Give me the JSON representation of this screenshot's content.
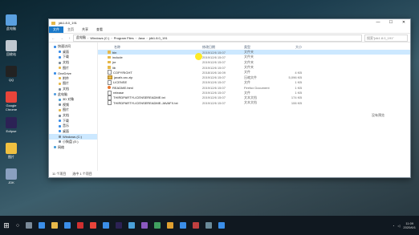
{
  "desktop_icons": [
    {
      "label": "此电脑",
      "color": "#5aa0e0"
    },
    {
      "label": "回收站",
      "color": "#c0c8d0"
    },
    {
      "label": "QQ",
      "color": "#222222"
    },
    {
      "label": "Google Chrome",
      "color": "#e8443a"
    },
    {
      "label": "Eclipse",
      "color": "#2c2255"
    },
    {
      "label": "图片",
      "color": "#f0c040"
    },
    {
      "label": "JDK",
      "color": "#8aa0c0"
    }
  ],
  "window": {
    "title_path": "jdk1.8.0_191",
    "controls": [
      "—",
      "☐",
      "✕"
    ],
    "ribbon_tabs": [
      "文件",
      "主页",
      "共享",
      "查看"
    ],
    "nav": [
      "←",
      "→",
      "↑"
    ],
    "breadcrumbs": [
      "此电脑",
      "Windows (C:)",
      "Program Files",
      "Java",
      "jdk1.8.0_191"
    ],
    "search_placeholder": "搜索\"jdk1.8.0_191\"",
    "sidebar": [
      {
        "label": "快速访问",
        "level": 1,
        "color": "#3b8ee8"
      },
      {
        "label": "桌面",
        "level": 2,
        "color": "#3b8ee8"
      },
      {
        "label": "下载",
        "level": 2,
        "color": "#3b8ee8"
      },
      {
        "label": "文档",
        "level": 2,
        "color": "#7a8a99"
      },
      {
        "label": "图片",
        "level": 2,
        "color": "#e6b84a"
      },
      {
        "label": "OneDrive",
        "level": 1,
        "color": "#3b8ee8"
      },
      {
        "label": "附件",
        "level": 2,
        "color": "#e6b84a"
      },
      {
        "label": "图片",
        "level": 2,
        "color": "#e6b84a"
      },
      {
        "label": "文档",
        "level": 2,
        "color": "#7a8a99"
      },
      {
        "label": "此电脑",
        "level": 1,
        "color": "#5aa0e0"
      },
      {
        "label": "3D 对象",
        "level": 2,
        "color": "#4aa0d8"
      },
      {
        "label": "视频",
        "level": 2,
        "color": "#7a8a99"
      },
      {
        "label": "图片",
        "level": 2,
        "color": "#e6b84a"
      },
      {
        "label": "文档",
        "level": 2,
        "color": "#7a8a99"
      },
      {
        "label": "下载",
        "level": 2,
        "color": "#3b8ee8"
      },
      {
        "label": "音乐",
        "level": 2,
        "color": "#3b8ee8"
      },
      {
        "label": "桌面",
        "level": 2,
        "color": "#3b8ee8"
      },
      {
        "label": "Windows (C:)",
        "level": 2,
        "color": "#7a8a99",
        "selected": true
      },
      {
        "label": "小狗盘 (E:)",
        "level": 2,
        "color": "#7a8a99"
      },
      {
        "label": "网络",
        "level": 1,
        "color": "#4aa0d8"
      }
    ],
    "columns": {
      "name": "名称",
      "date": "修改日期",
      "type": "类型",
      "size": "大小"
    },
    "files": [
      {
        "name": "bin",
        "date": "2019/12/6 15:07",
        "type": "文件夹",
        "size": "",
        "icon": "folder",
        "selected": true
      },
      {
        "name": "include",
        "date": "2019/12/6 15:07",
        "type": "文件夹",
        "size": "",
        "icon": "folder"
      },
      {
        "name": "jre",
        "date": "2019/12/6 15:07",
        "type": "文件夹",
        "size": "",
        "icon": "folder"
      },
      {
        "name": "lib",
        "date": "2019/12/6 15:07",
        "type": "文件夹",
        "size": "",
        "icon": "folder"
      },
      {
        "name": "COPYRIGHT",
        "date": "2018/10/6 16:09",
        "type": "文件",
        "size": "4 KB",
        "icon": "file"
      },
      {
        "name": "javafx-src.zip",
        "date": "2019/12/6 15:07",
        "type": "压缩文件",
        "size": "5,096 KB",
        "icon": "zip"
      },
      {
        "name": "LICENSE",
        "date": "2019/12/6 15:07",
        "type": "文件",
        "size": "1 KB",
        "icon": "file"
      },
      {
        "name": "README.html",
        "date": "2019/12/6 15:07",
        "type": "Firefox Document",
        "size": "1 KB",
        "icon": "html"
      },
      {
        "name": "release",
        "date": "2019/12/6 15:07",
        "type": "文件",
        "size": "1 KB",
        "icon": "file"
      },
      {
        "name": "THIRDPARTYLICENSEREADME.txt",
        "date": "2019/12/6 15:07",
        "type": "文本文档",
        "size": "174 KB",
        "icon": "file"
      },
      {
        "name": "THIRDPARTYLICENSEREADME-JAVAFX.txt",
        "date": "2019/12/6 15:07",
        "type": "文本文档",
        "size": "106 KB",
        "icon": "file"
      }
    ],
    "empty_hint": "没有预览",
    "status": {
      "count": "11 个项目",
      "selected": "选中 1 个项目"
    }
  },
  "taskbar": {
    "start_glyph": "⊞",
    "search_glyph": "○",
    "apps": [
      {
        "name": "task-view",
        "color": "#7a8a99"
      },
      {
        "name": "edge",
        "color": "#3b8ee8"
      },
      {
        "name": "file-explorer",
        "color": "#e6b84a"
      },
      {
        "name": "store",
        "color": "#3b8ee8"
      },
      {
        "name": "jdk-app",
        "color": "#d03030"
      },
      {
        "name": "chrome",
        "color": "#e8443a"
      },
      {
        "name": "qq",
        "color": "#3b8ee8"
      },
      {
        "name": "eclipse",
        "color": "#2c2255"
      },
      {
        "name": "app-9",
        "color": "#4aa0d8"
      },
      {
        "name": "app-10",
        "color": "#8a5ac0"
      },
      {
        "name": "app-11",
        "color": "#40a060"
      },
      {
        "name": "app-12",
        "color": "#e0a030"
      },
      {
        "name": "app-13",
        "color": "#3b8ee8"
      },
      {
        "name": "app-14",
        "color": "#c04040"
      },
      {
        "name": "app-15",
        "color": "#6a8a9a"
      },
      {
        "name": "app-16",
        "color": "#3b8ee8"
      }
    ],
    "time": "11:09",
    "date": "2020/6/1"
  }
}
